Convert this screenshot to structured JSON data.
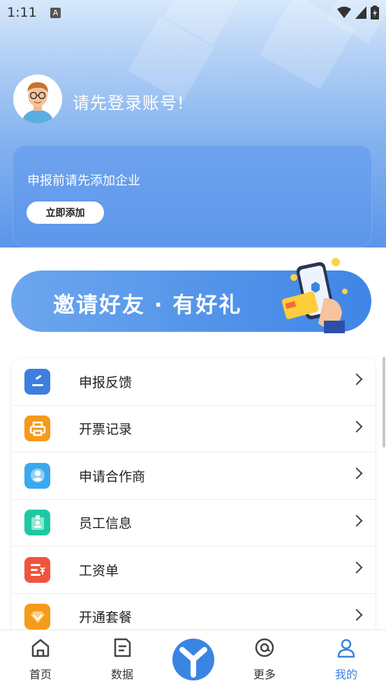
{
  "status_bar": {
    "time": "1:11",
    "notif_icon": "A"
  },
  "profile": {
    "login_prompt": "请先登录账号!"
  },
  "company_card": {
    "tip": "申报前请先添加企业",
    "add_button": "立即添加"
  },
  "invite_banner": {
    "text": "邀请好友 · 有好礼"
  },
  "menu": [
    {
      "label": "申报反馈",
      "icon": "feedback-icon",
      "color": "#3d7ee0"
    },
    {
      "label": "开票记录",
      "icon": "printer-icon",
      "color": "#f59a1b"
    },
    {
      "label": "申请合作商",
      "icon": "partner-icon",
      "color": "#3aa8ee"
    },
    {
      "label": "员工信息",
      "icon": "employee-badge-icon",
      "color": "#1dc9a4"
    },
    {
      "label": "工资单",
      "icon": "payslip-icon",
      "color": "#f0553c"
    },
    {
      "label": "开通套餐",
      "icon": "package-icon",
      "color": "#f59a1b"
    }
  ],
  "tabs": [
    {
      "label": "首页",
      "icon": "home-icon"
    },
    {
      "label": "数据",
      "icon": "document-icon"
    },
    {
      "label": "更多",
      "icon": "at-icon"
    },
    {
      "label": "我的",
      "icon": "user-icon",
      "active": true
    }
  ],
  "colors": {
    "accent": "#3b82e0",
    "header_top": "#d7e8fb",
    "header_bottom": "#5b95ea"
  }
}
